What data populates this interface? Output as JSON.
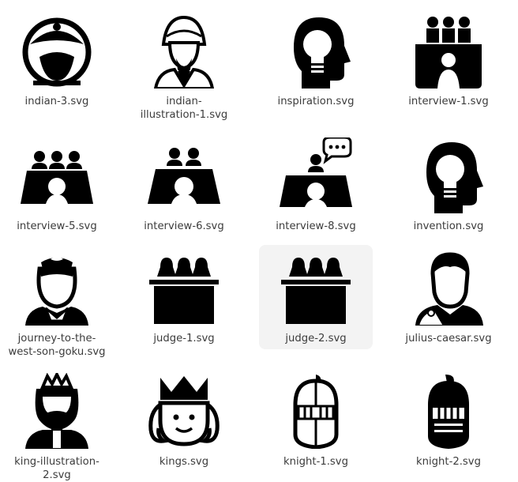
{
  "files": [
    {
      "label": "indian-3.svg",
      "icon": "turban-man-masked-icon"
    },
    {
      "label": "indian-illustration-1.svg",
      "icon": "turban-bearded-man-icon"
    },
    {
      "label": "inspiration.svg",
      "icon": "head-lightbulb-icon"
    },
    {
      "label": "interview-1.svg",
      "icon": "interview-panel-icon"
    },
    {
      "label": "interview-5.svg",
      "icon": "interview-table-icon"
    },
    {
      "label": "interview-6.svg",
      "icon": "interview-table-two-icon"
    },
    {
      "label": "interview-8.svg",
      "icon": "interview-speech-icon"
    },
    {
      "label": "invention.svg",
      "icon": "head-lightbulb-icon"
    },
    {
      "label": "journey-to-the-west-son-goku.svg",
      "icon": "son-goku-icon"
    },
    {
      "label": "judge-1.svg",
      "icon": "judges-bench-icon"
    },
    {
      "label": "judge-2.svg",
      "icon": "judges-bench-icon",
      "selected": true
    },
    {
      "label": "julius-caesar.svg",
      "icon": "julius-caesar-icon"
    },
    {
      "label": "king-illustration-2.svg",
      "icon": "king-icon"
    },
    {
      "label": "kings.svg",
      "icon": "crowned-face-icon"
    },
    {
      "label": "knight-1.svg",
      "icon": "knight-helmet-icon"
    },
    {
      "label": "knight-2.svg",
      "icon": "knight-helmet-dark-icon"
    }
  ]
}
